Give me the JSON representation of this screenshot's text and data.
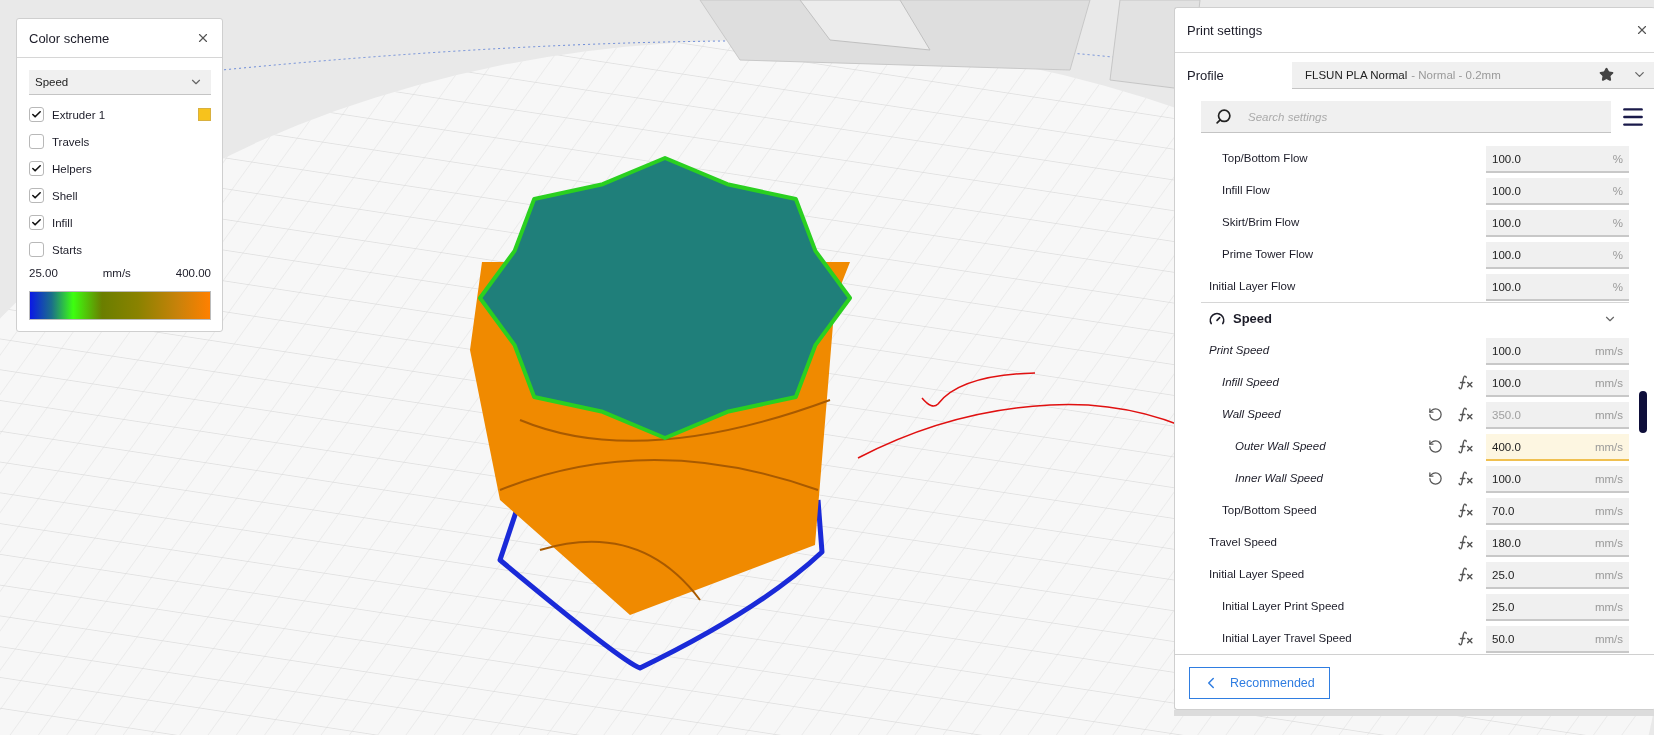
{
  "color_scheme": {
    "title": "Color scheme",
    "mode": "Speed",
    "items": [
      {
        "label": "Extruder 1",
        "checked": true,
        "color": "#f7c21c"
      },
      {
        "label": "Travels",
        "checked": false
      },
      {
        "label": "Helpers",
        "checked": true
      },
      {
        "label": "Shell",
        "checked": true
      },
      {
        "label": "Infill",
        "checked": true
      },
      {
        "label": "Starts",
        "checked": false
      }
    ],
    "legend": {
      "min": "25.00",
      "unit": "mm/s",
      "max": "400.00"
    }
  },
  "print_settings": {
    "title": "Print settings",
    "profile": {
      "label": "Profile",
      "name": "FLSUN PLA Normal",
      "detail": "- Normal - 0.2mm"
    },
    "search": {
      "placeholder": "Search settings"
    },
    "settings": [
      {
        "kind": "group",
        "children": [
          {
            "kind": "row",
            "label": "Top/Bottom Flow",
            "value": "100.0",
            "unit": "%",
            "calculated": false,
            "resettable": false,
            "formula": false,
            "inactive": false,
            "highlighted": false
          },
          {
            "kind": "row",
            "label": "Infill Flow",
            "value": "100.0",
            "unit": "%",
            "calculated": false,
            "resettable": false,
            "formula": false,
            "inactive": false,
            "highlighted": false
          },
          {
            "kind": "row",
            "label": "Skirt/Brim Flow",
            "value": "100.0",
            "unit": "%",
            "calculated": false,
            "resettable": false,
            "formula": false,
            "inactive": false,
            "highlighted": false
          },
          {
            "kind": "row",
            "label": "Prime Tower Flow",
            "value": "100.0",
            "unit": "%",
            "calculated": false,
            "resettable": false,
            "formula": false,
            "inactive": false,
            "highlighted": false
          }
        ]
      },
      {
        "kind": "row",
        "label": "Initial Layer Flow",
        "value": "100.0",
        "unit": "%",
        "calculated": false,
        "resettable": false,
        "formula": false,
        "inactive": false,
        "highlighted": false
      },
      {
        "kind": "section",
        "label": "Speed",
        "expanded": true
      },
      {
        "kind": "row",
        "label": "Print Speed",
        "value": "100.0",
        "unit": "mm/s",
        "calculated": true,
        "resettable": false,
        "formula": false,
        "inactive": false,
        "highlighted": false,
        "children": [
          {
            "kind": "row",
            "label": "Infill Speed",
            "value": "100.0",
            "unit": "mm/s",
            "calculated": true,
            "resettable": false,
            "formula": true,
            "inactive": false,
            "highlighted": false
          },
          {
            "kind": "row",
            "label": "Wall Speed",
            "value": "350.0",
            "unit": "mm/s",
            "calculated": true,
            "resettable": true,
            "formula": true,
            "inactive": true,
            "highlighted": false,
            "children": [
              {
                "kind": "row",
                "label": "Outer Wall Speed",
                "value": "400.0",
                "unit": "mm/s",
                "calculated": true,
                "resettable": true,
                "formula": true,
                "inactive": false,
                "highlighted": true
              },
              {
                "kind": "row",
                "label": "Inner Wall Speed",
                "value": "100.0",
                "unit": "mm/s",
                "calculated": true,
                "resettable": true,
                "formula": true,
                "inactive": false,
                "highlighted": false
              }
            ]
          },
          {
            "kind": "row",
            "label": "Top/Bottom Speed",
            "value": "70.0",
            "unit": "mm/s",
            "calculated": false,
            "resettable": false,
            "formula": true,
            "inactive": false,
            "highlighted": false
          }
        ]
      },
      {
        "kind": "row",
        "label": "Travel Speed",
        "value": "180.0",
        "unit": "mm/s",
        "calculated": false,
        "resettable": false,
        "formula": true,
        "inactive": false,
        "highlighted": false
      },
      {
        "kind": "row",
        "label": "Initial Layer Speed",
        "value": "25.0",
        "unit": "mm/s",
        "calculated": false,
        "resettable": false,
        "formula": true,
        "inactive": false,
        "highlighted": false,
        "children": [
          {
            "kind": "row",
            "label": "Initial Layer Print Speed",
            "value": "25.0",
            "unit": "mm/s",
            "calculated": false,
            "resettable": false,
            "formula": false,
            "inactive": false,
            "highlighted": false
          },
          {
            "kind": "row",
            "label": "Initial Layer Travel Speed",
            "value": "50.0",
            "unit": "mm/s",
            "calculated": false,
            "resettable": false,
            "formula": true,
            "inactive": false,
            "highlighted": false
          }
        ]
      }
    ],
    "footer_button": "Recommended"
  }
}
